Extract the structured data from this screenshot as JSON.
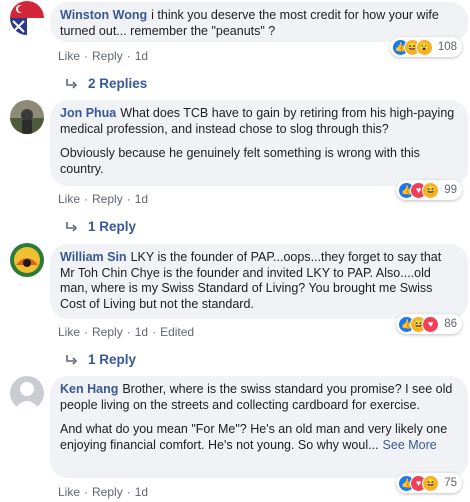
{
  "actions": {
    "like": "Like",
    "reply": "Reply",
    "separator": "·",
    "edited": "Edited"
  },
  "comments": [
    {
      "author": "Winston Wong",
      "paragraphs": [
        "i think you deserve the most credit for how your wife turned out... remember the \"peanuts\" ?"
      ],
      "time": "1d",
      "reactions": [
        "like",
        "haha",
        "wow"
      ],
      "reaction_count": "108",
      "replies": "2 Replies"
    },
    {
      "author": "Jon Phua",
      "paragraphs": [
        "What does TCB have to gain by retiring from his high-paying medical profession, and instead chose to slog through this?",
        "Obviously because he genuinely felt something is wrong with this country."
      ],
      "time": "1d",
      "reactions": [
        "like",
        "love",
        "haha"
      ],
      "reaction_count": "99",
      "replies": "1 Reply"
    },
    {
      "author": "William Sin",
      "paragraphs": [
        "LKY is the founder of PAP...oops...they forget to say that Mr Toh Chin Chye is the founder and invited LKY to PAP. Also....old man, where is my Swiss Standard of Living? You brought me Swiss Cost of Living but not the standard."
      ],
      "time": "1d",
      "reactions": [
        "like",
        "haha",
        "love"
      ],
      "reaction_count": "86",
      "replies": "1 Reply"
    },
    {
      "author": "Ken Hang",
      "paragraphs": [
        "Brother, where is the swiss standard you promise? I see old people living on the streets and collecting cardboard for exercise.",
        "And what do you mean \"For Me\"? He's an old man and very likely one enjoying financial comfort. He's not young. So why woul..."
      ],
      "see_more": "See More",
      "time": "1d",
      "reactions": [
        "like",
        "love",
        "haha"
      ],
      "reaction_count": "75"
    }
  ]
}
